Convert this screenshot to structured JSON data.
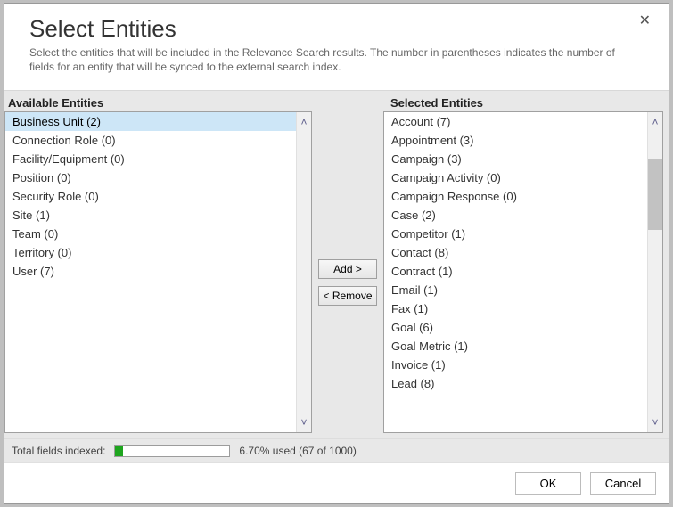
{
  "header": {
    "title": "Select Entities",
    "description": "Select the entities that will be included in the Relevance Search results. The number in parentheses indicates the number of fields for an entity that will be synced to the external search index.",
    "close_glyph": "✕"
  },
  "columns": {
    "available_label": "Available Entities",
    "selected_label": "Selected Entities"
  },
  "available": [
    {
      "label": "Business Unit (2)",
      "selected": true
    },
    {
      "label": "Connection Role (0)"
    },
    {
      "label": "Facility/Equipment (0)"
    },
    {
      "label": "Position (0)"
    },
    {
      "label": "Security Role (0)"
    },
    {
      "label": "Site (1)"
    },
    {
      "label": "Team (0)"
    },
    {
      "label": "Territory (0)"
    },
    {
      "label": "User (7)"
    }
  ],
  "selected": [
    {
      "label": "Account (7)"
    },
    {
      "label": "Appointment (3)"
    },
    {
      "label": "Campaign (3)"
    },
    {
      "label": "Campaign Activity (0)"
    },
    {
      "label": "Campaign Response (0)"
    },
    {
      "label": "Case (2)"
    },
    {
      "label": "Competitor (1)"
    },
    {
      "label": "Contact (8)"
    },
    {
      "label": "Contract (1)"
    },
    {
      "label": "Email (1)"
    },
    {
      "label": "Fax (1)"
    },
    {
      "label": "Goal (6)"
    },
    {
      "label": "Goal Metric (1)"
    },
    {
      "label": "Invoice (1)"
    },
    {
      "label": "Lead (8)"
    }
  ],
  "buttons": {
    "add": "Add >",
    "remove": "< Remove",
    "ok": "OK",
    "cancel": "Cancel"
  },
  "status": {
    "label": "Total fields indexed:",
    "percent_text": "6.70% used (67 of 1000)",
    "percent_value": 6.7
  },
  "scroll": {
    "up_glyph": "˄",
    "down_glyph": "˅"
  }
}
